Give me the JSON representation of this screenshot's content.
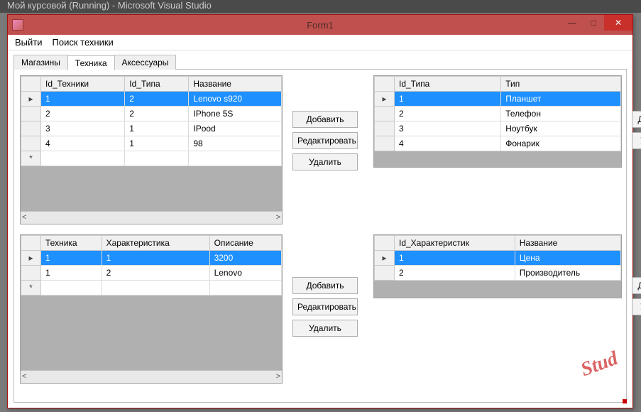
{
  "vs_title": "Мой курсовой (Running) - Microsoft Visual Studio",
  "window": {
    "title": "Form1"
  },
  "winbuttons": {
    "min": "—",
    "max": "□",
    "close": "✕"
  },
  "menu": {
    "exit": "Выйти",
    "search": "Поиск техники"
  },
  "tabs": {
    "t0": "Магазины",
    "t1": "Техника",
    "t2": "Аксессуары"
  },
  "buttons": {
    "add": "Добавить",
    "edit": "Редактировать",
    "delete": "Удалить"
  },
  "grids": {
    "g1": {
      "cols": {
        "c0": "Id_Техники",
        "c1": "Id_Типа",
        "c2": "Название"
      },
      "r0": {
        "c0": "1",
        "c1": "2",
        "c2": "Lenovo s920"
      },
      "r1": {
        "c0": "2",
        "c1": "2",
        "c2": "IPhone 5S"
      },
      "r2": {
        "c0": "3",
        "c1": "1",
        "c2": "IPood"
      },
      "r3": {
        "c0": "4",
        "c1": "1",
        "c2": "98"
      }
    },
    "g2": {
      "cols": {
        "c0": "Id_Типа",
        "c1": "Тип"
      },
      "r0": {
        "c0": "1",
        "c1": "Планшет"
      },
      "r1": {
        "c0": "2",
        "c1": "Телефон"
      },
      "r2": {
        "c0": "3",
        "c1": "Ноутбук"
      },
      "r3": {
        "c0": "4",
        "c1": "Фонарик"
      }
    },
    "g3": {
      "cols": {
        "c0": "Техника",
        "c1": "Характеристика",
        "c2": "Описание"
      },
      "r0": {
        "c0": "1",
        "c1": "1",
        "c2": "3200"
      },
      "r1": {
        "c0": "1",
        "c1": "2",
        "c2": "Lenovo"
      }
    },
    "g4": {
      "cols": {
        "c0": "Id_Характеристик",
        "c1": "Название"
      },
      "r0": {
        "c0": "1",
        "c1": "Цена"
      },
      "r1": {
        "c0": "2",
        "c1": "Производитель"
      }
    }
  },
  "rowmarkers": {
    "sel": "▸",
    "new": "*"
  },
  "scroll": {
    "left": "<",
    "right": ">"
  },
  "watermark": "Stud"
}
